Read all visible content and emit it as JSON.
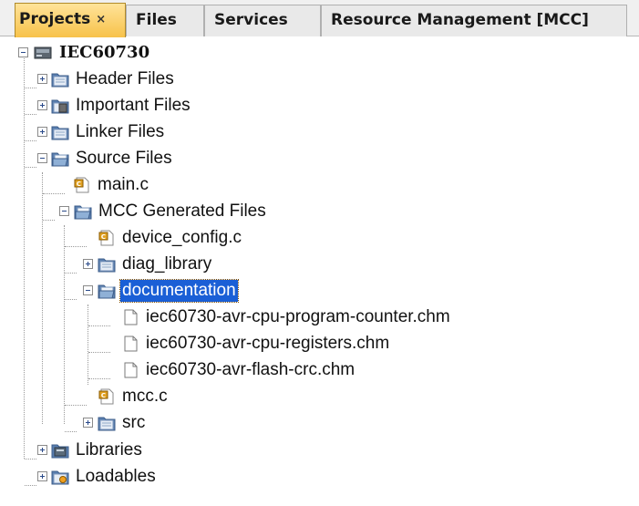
{
  "tabs": [
    {
      "label": "Projects",
      "close": "×"
    },
    {
      "label": "Files"
    },
    {
      "label": "Services"
    },
    {
      "label": "Resource Management [MCC]"
    }
  ],
  "tree": {
    "project": "IEC60730",
    "header_files": "Header Files",
    "important_files": "Important Files",
    "linker_files": "Linker Files",
    "source_files": "Source Files",
    "main_c": "main.c",
    "mcc_generated_files": "MCC Generated Files",
    "device_config_c": "device_config.c",
    "diag_library": "diag_library",
    "documentation": "documentation",
    "doc_files": [
      "iec60730-avr-cpu-program-counter.chm",
      "iec60730-avr-cpu-registers.chm",
      "iec60730-avr-flash-crc.chm"
    ],
    "mcc_c": "mcc.c",
    "src": "src",
    "libraries": "Libraries",
    "loadables": "Loadables"
  },
  "colors": {
    "active_tab": "#f7c24a",
    "selection": "#1a5fd6"
  }
}
